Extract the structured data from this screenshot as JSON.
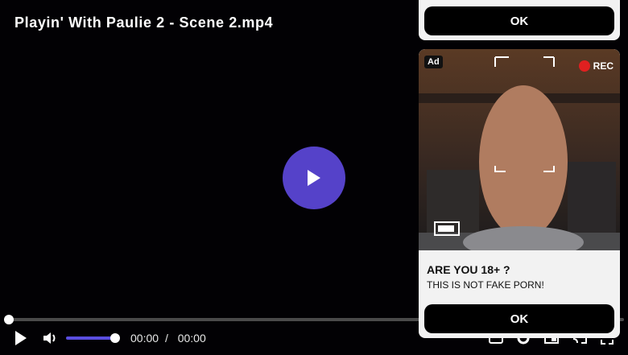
{
  "player": {
    "title": "Playin' With Paulie 2 - Scene 2.mp4",
    "current_time": "00:00",
    "separator": "/",
    "duration": "00:00",
    "progress": 0.0,
    "volume": 1.0,
    "accent_color": "#5542c9",
    "icons": [
      "play-icon",
      "volume-icon",
      "captions-icon",
      "settings-icon",
      "pip-icon",
      "cast-icon",
      "fullscreen-icon"
    ]
  },
  "ad": {
    "top_ok_label": "OK",
    "badge": "Ad",
    "rec_label": "REC",
    "headline": "ARE YOU 18+ ?",
    "subtext": "THIS IS NOT FAKE PORN!",
    "ok_label": "OK"
  }
}
